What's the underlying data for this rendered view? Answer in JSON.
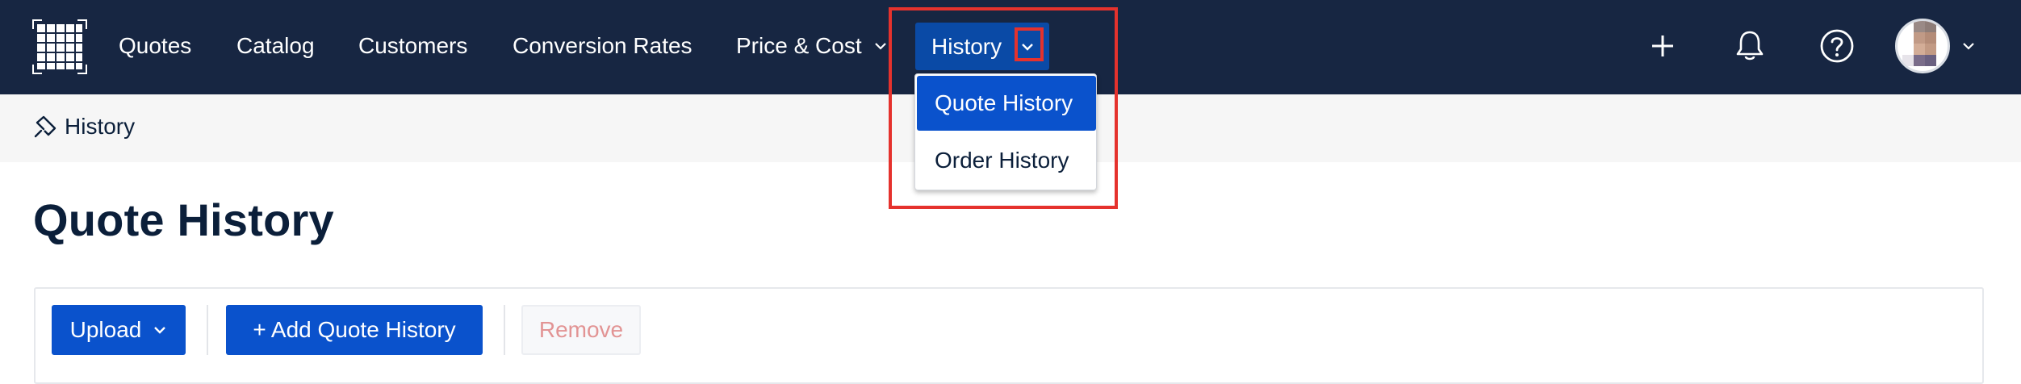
{
  "nav": {
    "items": [
      {
        "label": "Quotes"
      },
      {
        "label": "Catalog"
      },
      {
        "label": "Customers"
      },
      {
        "label": "Conversion Rates"
      },
      {
        "label": "Price & Cost"
      }
    ],
    "active": {
      "label": "History"
    }
  },
  "history_menu": {
    "items": [
      {
        "label": "Quote History",
        "selected": true
      },
      {
        "label": "Order History",
        "selected": false
      }
    ]
  },
  "breadcrumb": {
    "label": "History"
  },
  "page": {
    "title": "Quote History"
  },
  "toolbar": {
    "upload_label": "Upload",
    "add_label": "+ Add Quote History",
    "remove_label": "Remove"
  },
  "icons": {
    "logo": "grid-logo-icon",
    "add": "plus-icon",
    "notifications": "bell-icon",
    "help": "question-circle-icon",
    "breadcrumb": "history-icon"
  },
  "colors": {
    "nav_bg": "#172642",
    "nav_active": "#0a4aa6",
    "primary": "#0a52cc",
    "highlight": "#e5322d",
    "disabled_text": "#e29494"
  }
}
